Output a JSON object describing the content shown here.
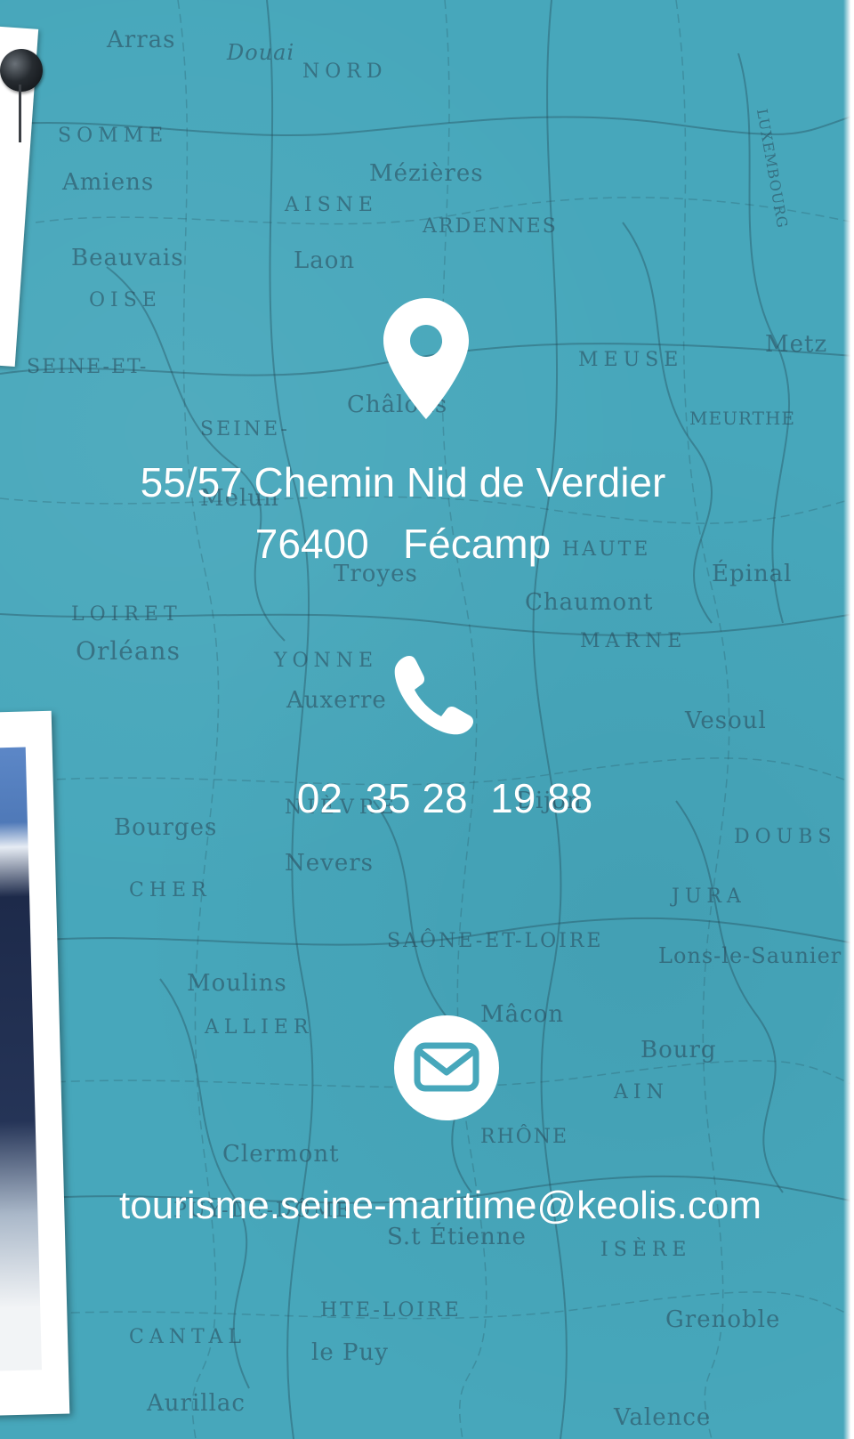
{
  "contact": {
    "address_line1": "55/57 Chemin Nid de Verdier",
    "address_line2": "76400   Fécamp",
    "phone": "02  35 28  19 88",
    "email": "tourisme.seine-maritime@keolis.com"
  },
  "icons": {
    "location": "map-pin-icon",
    "phone": "phone-icon",
    "email": "envelope-icon"
  },
  "colors": {
    "map_background": "#47a7bb",
    "text": "#ffffff",
    "icon_fill": "#ffffff"
  },
  "map_labels": [
    "Arras",
    "Douai",
    "NORD",
    "SOMME",
    "Amiens",
    "Mézières",
    "AISNE",
    "ARDENNES",
    "Beauvais",
    "Laon",
    "OISE",
    "MEUSE",
    "Châlons",
    "SEINE-ET-",
    "SEINE-",
    "Melun",
    "LUXEMBOURG",
    "HAUTE",
    "Troyes",
    "Chaumont",
    "LOIRET",
    "Orléans",
    "YONNE",
    "Auxerre",
    "MARNE",
    "Vesoul",
    "Dijon",
    "Bourges",
    "NIÈVRE",
    "Nevers",
    "CHER",
    "DOUBS",
    "JURA",
    "SAÔNE-ET-LOIRE",
    "Lons-le-Saunier",
    "Moulins",
    "ALLIER",
    "Mâcon",
    "Bourg",
    "AIN",
    "RHÔNE",
    "Clermont",
    "PUY-DE-DÔME",
    "S.t Étienne",
    "ISÈRE",
    "Grenoble",
    "HTE-LOIRE",
    "CANTAL",
    "le Puy",
    "Aurillac",
    "Valence",
    "Épinal",
    "Metz",
    "MEURTHE"
  ]
}
